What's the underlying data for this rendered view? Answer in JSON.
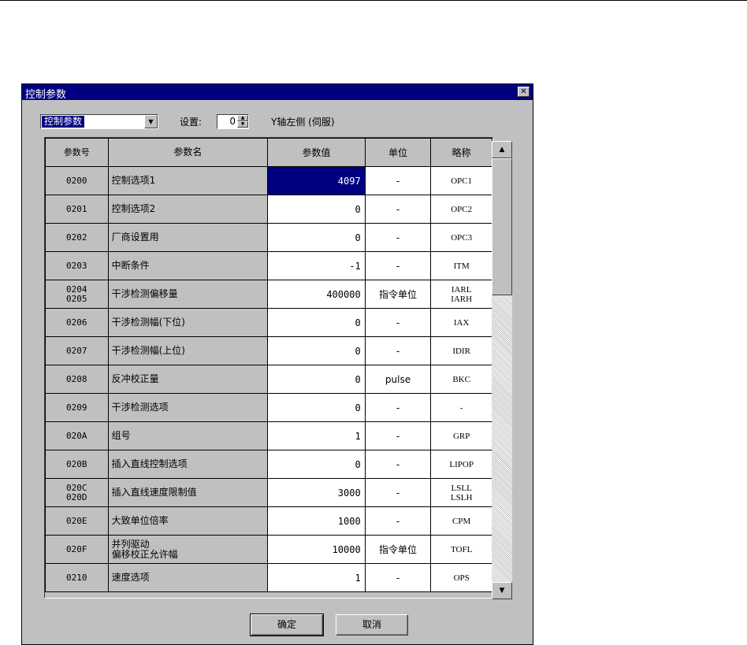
{
  "window": {
    "title": "控制参数",
    "close_glyph": "✕"
  },
  "toolbar": {
    "combo_value": "控制参数",
    "setting_label": "设置:",
    "setting_value": "0",
    "axis_text": "Y轴左侧 (伺服)"
  },
  "columns": [
    "参数号",
    "参数名",
    "参数值",
    "单位",
    "略称"
  ],
  "rows": [
    {
      "no": "0200",
      "name": "控制选项1",
      "value": "4097",
      "unit": "-",
      "abbr": "OPC1",
      "selected": true
    },
    {
      "no": "0201",
      "name": "控制选项2",
      "value": "0",
      "unit": "-",
      "abbr": "OPC2"
    },
    {
      "no": "0202",
      "name": "厂商设置用",
      "value": "0",
      "unit": "-",
      "abbr": "OPC3"
    },
    {
      "no": "0203",
      "name": "中断条件",
      "value": "-1",
      "unit": "-",
      "abbr": "ITM"
    },
    {
      "no": "0204\n0205",
      "name": "干涉检测偏移量",
      "value": "400000",
      "unit": "指令单位",
      "abbr": "IARL\nIARH"
    },
    {
      "no": "0206",
      "name": "干涉检测幅(下位)",
      "value": "0",
      "unit": "-",
      "abbr": "IAX"
    },
    {
      "no": "0207",
      "name": "干涉检测幅(上位)",
      "value": "0",
      "unit": "-",
      "abbr": "IDIR"
    },
    {
      "no": "0208",
      "name": "反冲校正量",
      "value": "0",
      "unit": "pulse",
      "abbr": "BKC"
    },
    {
      "no": "0209",
      "name": "干涉检测选项",
      "value": "0",
      "unit": "-",
      "abbr": "-"
    },
    {
      "no": "020A",
      "name": "组号",
      "value": "1",
      "unit": "-",
      "abbr": "GRP"
    },
    {
      "no": "020B",
      "name": "插入直线控制选项",
      "value": "0",
      "unit": "-",
      "abbr": "LIPOP"
    },
    {
      "no": "020C\n020D",
      "name": "插入直线速度限制值",
      "value": "3000",
      "unit": "-",
      "abbr": "LSLL\nLSLH"
    },
    {
      "no": "020E",
      "name": "大致单位倍率",
      "value": "1000",
      "unit": "-",
      "abbr": "CPM"
    },
    {
      "no": "020F",
      "name": "并列驱动\n偏移校正允许幅",
      "value": "10000",
      "unit": "指令单位",
      "abbr": "TOFL"
    },
    {
      "no": "0210",
      "name": "速度选项",
      "value": "1",
      "unit": "-",
      "abbr": "OPS"
    }
  ],
  "buttons": {
    "ok": "确定",
    "cancel": "取消"
  },
  "colors": {
    "title_bar": "#000080",
    "dialog_face": "#c0c0c0",
    "selection": "#000080"
  }
}
